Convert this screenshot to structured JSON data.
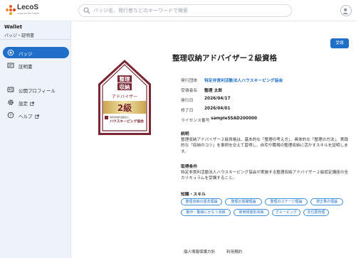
{
  "header": {
    "logo_text": "LecoS",
    "logo_tagline": "Learn for the Future",
    "search_placeholder": "バッジ名、発行者などのキーワードで検索"
  },
  "sidebar": {
    "title": "Wallet",
    "subtitle": "バッジ・証明書",
    "items": [
      {
        "label": "バッジ"
      },
      {
        "label": "証明書"
      },
      {
        "label": "公開プロフィール"
      },
      {
        "label": "設定"
      },
      {
        "label": "ヘルプ"
      }
    ]
  },
  "main": {
    "action_button": "受領",
    "badge_graphic": {
      "line1": "整理",
      "line2": "収納",
      "line3": "アドバイザー",
      "grade": "2級",
      "org_small": "特定非営利活動法人",
      "org": "ハウスキーピング協会"
    },
    "title": "整理収納アドバイザー２級資格",
    "info": [
      {
        "label": "発行団体",
        "value": "特定非営利活動法人ハウスキーピング協会"
      },
      {
        "label": "受領者名",
        "value": "整理 太郎"
      },
      {
        "label": "発行日",
        "value": "2026/04/17"
      },
      {
        "label": "修了日",
        "value": "2026/04/01"
      },
      {
        "label": "ライセンス番号",
        "value": "sampleSSAD200000"
      }
    ],
    "description_heading": "説明",
    "description": "整理収納アドバイザー２級資格は、基本的な「整理の考え方」、具体的な「整理の方法」、実践的な「収納のコツ」を事例を交えて習得し、自宅や職場の整理収納に活かすスキルを証明します。",
    "conditions_heading": "取得条件",
    "conditions": "特定非営利活動法人ハウスキーピング協会が実施する整理収納アドバイザー２級認定講座の全カリキュラムを受講すること。",
    "skills_heading": "知識・スキル",
    "skills": [
      "整理収納の基本理論",
      "整理の基礎理論",
      "整理のステージ理論",
      "適正量の理論",
      "動作・動線にかなう収納",
      "使用頻度別収納",
      "グルーピング",
      "定位置管理"
    ]
  },
  "footer": {
    "links": [
      "個人情報保護方針",
      "利用規約"
    ]
  },
  "colors": {
    "accent": "#1f6fc9",
    "badge_maroon": "#7a2733",
    "badge_gold": "#b8943c",
    "sidebar_bg": "#eef3fb"
  }
}
